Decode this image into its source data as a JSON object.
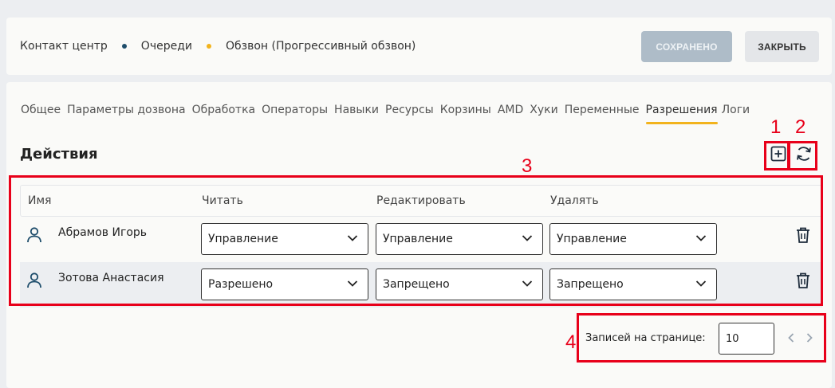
{
  "breadcrumb": {
    "items": [
      "Контакт центр",
      "Очереди",
      "Обзвон (Прогрессивный обзвон)"
    ],
    "separator_colors": [
      "#1e4d6b",
      "#f2b31d"
    ]
  },
  "toolbar": {
    "saved_label": "СОХРАНЕНО",
    "close_label": "ЗАКРЫТЬ"
  },
  "tabs": [
    {
      "label": "Общее"
    },
    {
      "label": "Параметры дозвона"
    },
    {
      "label": "Обработка"
    },
    {
      "label": "Операторы"
    },
    {
      "label": "Навыки"
    },
    {
      "label": "Ресурсы"
    },
    {
      "label": "Корзины"
    },
    {
      "label": "AMD"
    },
    {
      "label": "Хуки"
    },
    {
      "label": "Переменные"
    },
    {
      "label": "Разрешения",
      "active": true
    },
    {
      "label": "Логи"
    }
  ],
  "section": {
    "title": "Действия",
    "add_icon": "plus-square-icon",
    "refresh_icon": "refresh-icon"
  },
  "table": {
    "columns": [
      "Имя",
      "Читать",
      "Редактировать",
      "Удалять"
    ],
    "rows": [
      {
        "name": "Абрамов Игорь",
        "read": "Управление",
        "edit": "Управление",
        "delete": "Управление"
      },
      {
        "name": "Зотова Анастасия",
        "read": "Разрешено",
        "edit": "Запрещено",
        "delete": "Запрещено"
      }
    ]
  },
  "pager": {
    "label": "Записей на странице:",
    "page_size": "10"
  },
  "annotations": [
    "1",
    "2",
    "3",
    "4"
  ],
  "colors": {
    "accent": "#f2b31d",
    "annotation": "#e8001a",
    "saved_button": "#aebcc8",
    "dark_blue": "#1e4d6b"
  }
}
